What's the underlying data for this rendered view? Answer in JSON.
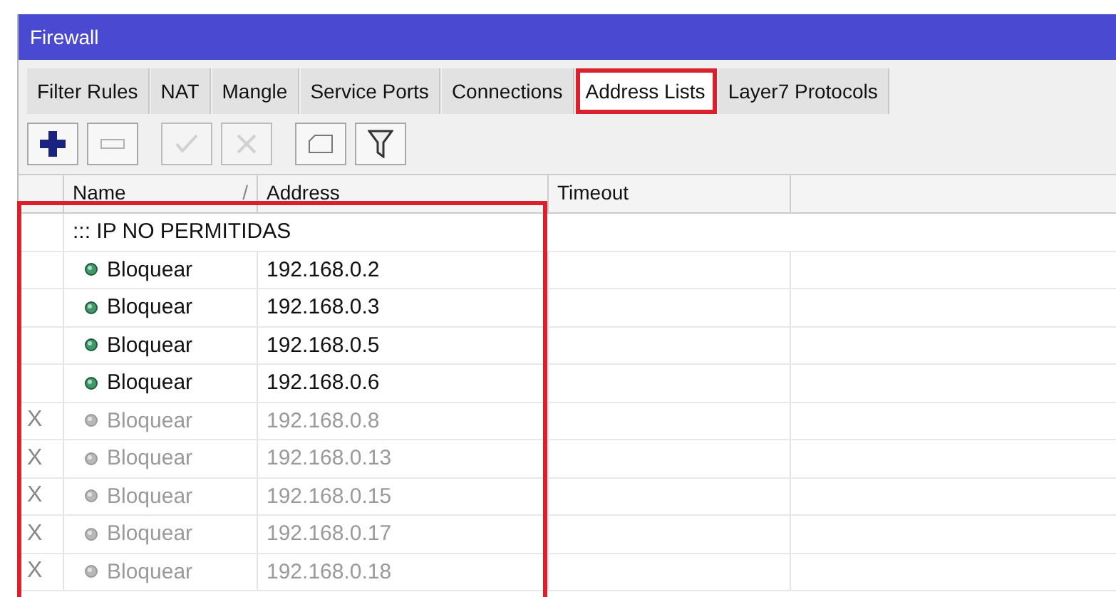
{
  "window": {
    "title": "Firewall"
  },
  "tabs": [
    {
      "label": "Filter Rules",
      "selected": false,
      "highlighted": false
    },
    {
      "label": "NAT",
      "selected": false,
      "highlighted": false
    },
    {
      "label": "Mangle",
      "selected": false,
      "highlighted": false
    },
    {
      "label": "Service Ports",
      "selected": false,
      "highlighted": false
    },
    {
      "label": "Connections",
      "selected": false,
      "highlighted": false
    },
    {
      "label": "Address Lists",
      "selected": true,
      "highlighted": true
    },
    {
      "label": "Layer7 Protocols",
      "selected": false,
      "highlighted": false
    }
  ],
  "toolbar": [
    {
      "kind": "add",
      "disabled": false
    },
    {
      "kind": "remove",
      "disabled": false
    },
    {
      "kind": "enable",
      "disabled": true
    },
    {
      "kind": "disable",
      "disabled": true
    },
    {
      "kind": "comment",
      "disabled": false
    },
    {
      "kind": "filter",
      "disabled": false
    }
  ],
  "table": {
    "columns": [
      {
        "label": "Name",
        "sort": "/"
      },
      {
        "label": "Address"
      },
      {
        "label": "Timeout"
      }
    ],
    "highlighted": true,
    "rows": [
      {
        "kind": "comment",
        "text": "::: IP NO PERMITIDAS"
      },
      {
        "kind": "entry",
        "disabled": false,
        "name": "Bloquear",
        "address": "192.168.0.2"
      },
      {
        "kind": "entry",
        "disabled": false,
        "name": "Bloquear",
        "address": "192.168.0.3"
      },
      {
        "kind": "entry",
        "disabled": false,
        "name": "Bloquear",
        "address": "192.168.0.5"
      },
      {
        "kind": "entry",
        "disabled": false,
        "name": "Bloquear",
        "address": "192.168.0.6"
      },
      {
        "kind": "entry",
        "disabled": true,
        "flag": "X",
        "name": "Bloquear",
        "address": "192.168.0.8"
      },
      {
        "kind": "entry",
        "disabled": true,
        "flag": "X",
        "name": "Bloquear",
        "address": "192.168.0.13"
      },
      {
        "kind": "entry",
        "disabled": true,
        "flag": "X",
        "name": "Bloquear",
        "address": "192.168.0.15"
      },
      {
        "kind": "entry",
        "disabled": true,
        "flag": "X",
        "name": "Bloquear",
        "address": "192.168.0.17"
      },
      {
        "kind": "entry",
        "disabled": true,
        "flag": "X",
        "name": "Bloquear",
        "address": "192.168.0.18"
      }
    ]
  }
}
